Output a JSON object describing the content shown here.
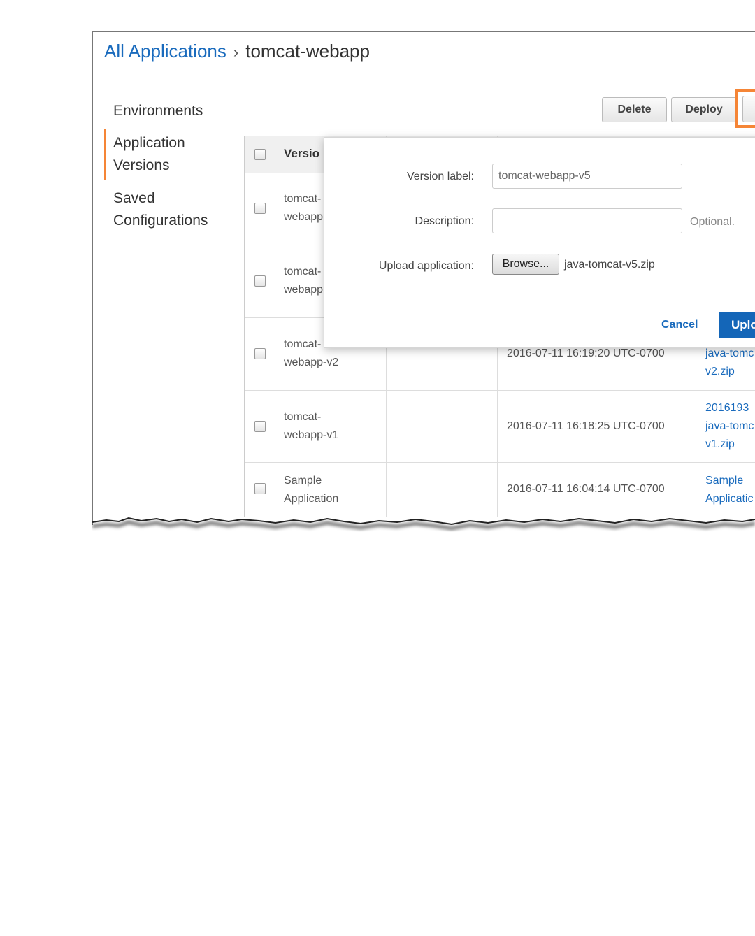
{
  "breadcrumb": {
    "link": "All Applications",
    "separator": "›",
    "current": "tomcat-webapp"
  },
  "nav": {
    "environments": "Environments",
    "app_versions_line1": "Application",
    "app_versions_line2": "Versions",
    "saved_line1": "Saved",
    "saved_line2": "Configurations"
  },
  "toolbar": {
    "delete": "Delete",
    "deploy": "Deploy"
  },
  "table": {
    "header_version": "Versio",
    "rows": [
      {
        "version1": "tomcat-",
        "version2": "webapp"
      },
      {
        "version1": "tomcat-",
        "version2": "webapp"
      },
      {
        "version1": "tomcat-",
        "version2": "webapp-v2",
        "date": "2016-07-11 16:19:20 UTC-0700",
        "source1": "java-tomc",
        "source2": "v2.zip"
      },
      {
        "version1": "tomcat-",
        "version2": "webapp-v1",
        "date": "2016-07-11 16:18:25 UTC-0700",
        "source1": "2016193",
        "source2": "java-tomc",
        "source3": "v1.zip"
      },
      {
        "version1": "Sample",
        "version2": "Application",
        "date": "2016-07-11 16:04:14 UTC-0700",
        "source1": "Sample",
        "source2": "Applicatic"
      }
    ]
  },
  "modal": {
    "version_label": "Version label:",
    "version_value": "tomcat-webapp-v5",
    "description_label": "Description:",
    "description_value": "",
    "optional": "Optional.",
    "upload_label": "Upload application:",
    "browse": "Browse...",
    "file_name": "java-tomcat-v5.zip",
    "cancel": "Cancel",
    "upload": "Uplo"
  }
}
